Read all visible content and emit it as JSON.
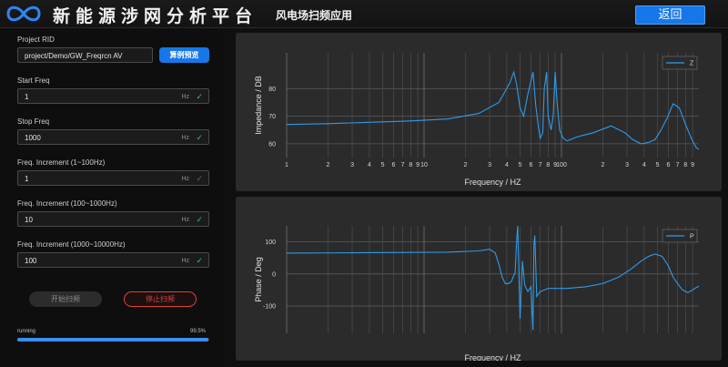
{
  "header": {
    "title": "新能源涉网分析平台",
    "subtitle": "风电场扫频应用",
    "back_label": "返回"
  },
  "form": {
    "project_path": {
      "label": "Project RID",
      "value": "project/Demo/GW_Freqrcn AV"
    },
    "view_button": "算例预览",
    "start_freq": {
      "label": "Start Freq",
      "value": "1",
      "unit": "Hz"
    },
    "stop_freq": {
      "label": "Stop Freq",
      "value": "1000",
      "unit": "Hz"
    },
    "inc1": {
      "label": "Freq. Increment (1~100Hz)",
      "value": "1",
      "unit": "Hz"
    },
    "inc2": {
      "label": "Freq. Increment (100~1000Hz)",
      "value": "10",
      "unit": "Hz"
    },
    "inc3": {
      "label": "Freq. Increment (1000~10000Hz)",
      "value": "100",
      "unit": "Hz"
    }
  },
  "actions": {
    "start_label": "开始扫频",
    "stop_label": "停止扫频"
  },
  "status": {
    "label": "running",
    "percent_text": "99.5%",
    "progress": 0.995
  },
  "colors": {
    "accent": "#1677e8",
    "series": "#2f9be8",
    "stop": "#e0403a",
    "ok": "#45c14f"
  },
  "chart_data": [
    {
      "type": "line",
      "xlabel": "Frequency / HZ",
      "ylabel": "Impedance / DB",
      "xscale": "log",
      "xlim": [
        1,
        1000
      ],
      "ylim": [
        55,
        93
      ],
      "yticks": [
        60,
        70,
        80
      ],
      "xtick_labels": [
        "1",
        "10",
        "100"
      ],
      "minor_tick_labels": [
        "2",
        "3",
        "4",
        "5",
        "6",
        "7",
        "8",
        "9"
      ],
      "legend": "top-right",
      "series": [
        {
          "name": "Z",
          "x": [
            1,
            2,
            4,
            8,
            15,
            25,
            35,
            42,
            45,
            47,
            50,
            53,
            57,
            62,
            65,
            68,
            70,
            73,
            75,
            78,
            80,
            84,
            87,
            90,
            93,
            97,
            103,
            110,
            130,
            170,
            230,
            290,
            330,
            380,
            430,
            480,
            530,
            590,
            650,
            720,
            800,
            880,
            960,
            1000
          ],
          "y": [
            67,
            67.3,
            67.8,
            68.3,
            69,
            71,
            75,
            82,
            86,
            82,
            73,
            70,
            78,
            86,
            74,
            66,
            62,
            64,
            80,
            86,
            70,
            65,
            70,
            86,
            75,
            65,
            62,
            61,
            62.5,
            64,
            66.5,
            64,
            61.5,
            60,
            60.5,
            61.5,
            65,
            69.5,
            74.5,
            73,
            67,
            62,
            58.5,
            58
          ]
        }
      ]
    },
    {
      "type": "line",
      "xlabel": "Frequency / HZ",
      "ylabel": "Phase / Deg",
      "xscale": "log",
      "xlim": [
        1,
        1000
      ],
      "ylim": [
        -185,
        150
      ],
      "yticks": [
        -100,
        0,
        100
      ],
      "legend": "top-right",
      "series": [
        {
          "name": "P",
          "x": [
            1,
            3,
            8,
            15,
            25,
            30,
            33,
            35,
            37,
            39,
            41,
            43,
            46,
            47,
            48,
            50,
            52,
            54,
            57,
            60,
            62,
            63,
            64,
            66,
            70,
            75,
            80,
            90,
            110,
            150,
            200,
            260,
            320,
            380,
            430,
            480,
            540,
            600,
            650,
            700,
            760,
            830,
            900,
            960,
            1000
          ],
          "y": [
            65,
            66,
            67,
            68,
            72,
            77,
            65,
            30,
            -10,
            -30,
            -30,
            -25,
            5,
            90,
            150,
            -140,
            40,
            -35,
            -55,
            -40,
            -175,
            90,
            120,
            -70,
            -55,
            -50,
            -45,
            -45,
            -45,
            -40,
            -30,
            -10,
            15,
            40,
            55,
            62,
            55,
            25,
            -10,
            -30,
            -50,
            -58,
            -50,
            -42,
            -38
          ]
        }
      ]
    }
  ]
}
